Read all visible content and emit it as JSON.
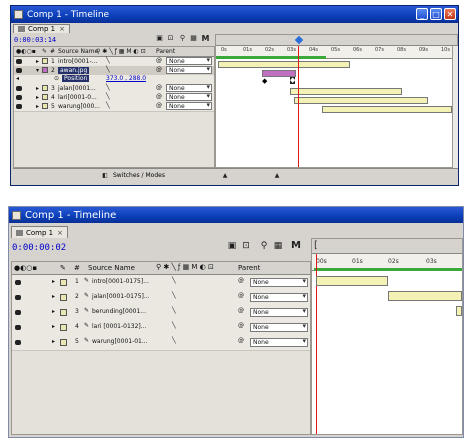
{
  "top": {
    "title": "Comp 1 - Timeline",
    "tab": "Comp 1",
    "timecode": "0:00:03:14",
    "ruler_labels": [
      "0s",
      "01s",
      "02s",
      "03s",
      "04s",
      "05s",
      "06s",
      "07s",
      "08s",
      "09s",
      "10s"
    ],
    "headers": {
      "num": "#",
      "source": "Source Name",
      "parent": "Parent"
    },
    "layers": [
      {
        "num": "1",
        "name": "intro[0001-...",
        "parent": "None"
      },
      {
        "num": "2",
        "name": "awan.jpg",
        "parent": "None"
      },
      {
        "num": "",
        "name": "Position",
        "value": "373.0 , 288.0",
        "parent": ""
      },
      {
        "num": "3",
        "name": "jalan[0001...",
        "parent": "None"
      },
      {
        "num": "4",
        "name": "lari[0001-0...",
        "parent": "None"
      },
      {
        "num": "5",
        "name": "warung[000...",
        "parent": "None"
      }
    ],
    "footer": "Switches / Modes"
  },
  "bottom": {
    "title": "Comp 1 - Timeline",
    "tab": "Comp 1",
    "timecode": "0:00:00:02",
    "ruler_labels": [
      "00s",
      "01s",
      "02s",
      "03s"
    ],
    "headers": {
      "num": "#",
      "source": "Source Name",
      "parent": "Parent"
    },
    "layers": [
      {
        "num": "1",
        "name": "intro[0001-0175]...",
        "parent": "None"
      },
      {
        "num": "2",
        "name": "jalan[0001-0175]...",
        "parent": "None"
      },
      {
        "num": "3",
        "name": "berunding[0001...",
        "parent": "None"
      },
      {
        "num": "4",
        "name": "lari [0001-0132]...",
        "parent": "None"
      },
      {
        "num": "5",
        "name": "warung[0001-01...",
        "parent": "None"
      }
    ]
  },
  "colors": {
    "title_bar": "#0a3fb8",
    "timecode": "#0000c8",
    "cti": "#e01818",
    "work_area": "#3aa83a",
    "layer_bar": "#f3f1b4",
    "selected_bar": "#c070c0"
  }
}
